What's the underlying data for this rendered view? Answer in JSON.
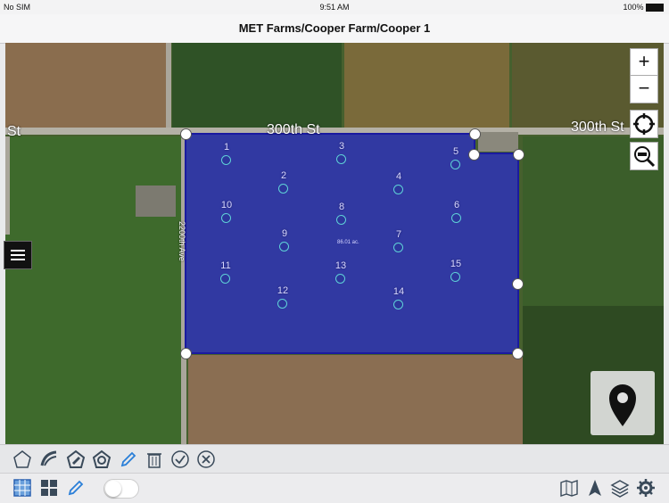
{
  "status": {
    "carrier": "No SIM",
    "time": "9:51 AM",
    "battery": "100%"
  },
  "nav": {
    "title": "MET Farms/Cooper Farm/Cooper 1"
  },
  "map": {
    "street_left": "St",
    "street_top": "300th St",
    "street_right": "300th St",
    "avenue": "2200th Ave",
    "area_label": "86.01 ac.",
    "boundary_color": "#2a2ad0",
    "sample_points": [
      {
        "label": "1"
      },
      {
        "label": "2"
      },
      {
        "label": "3"
      },
      {
        "label": "4"
      },
      {
        "label": "5"
      },
      {
        "label": "6"
      },
      {
        "label": "7"
      },
      {
        "label": "8"
      },
      {
        "label": "9"
      },
      {
        "label": "10"
      },
      {
        "label": "11"
      },
      {
        "label": "12"
      },
      {
        "label": "13"
      },
      {
        "label": "14"
      },
      {
        "label": "15"
      }
    ]
  },
  "controls": {
    "zoom_in": "+",
    "zoom_out": "−"
  },
  "toolbar": {
    "tools": [
      "pentagon-icon",
      "draw-curve-icon",
      "pen-nib-icon",
      "pentagon-gear-icon",
      "pencil-icon",
      "trash-icon",
      "check-circle-icon",
      "close-circle-icon"
    ],
    "bottom_left": [
      "grid-pattern-icon",
      "grid-blocks-icon",
      "pencil-icon"
    ],
    "bottom_right": [
      "map-icon",
      "navigation-arrow-icon",
      "layers-icon",
      "gear-icon"
    ],
    "toggle_on": false
  }
}
